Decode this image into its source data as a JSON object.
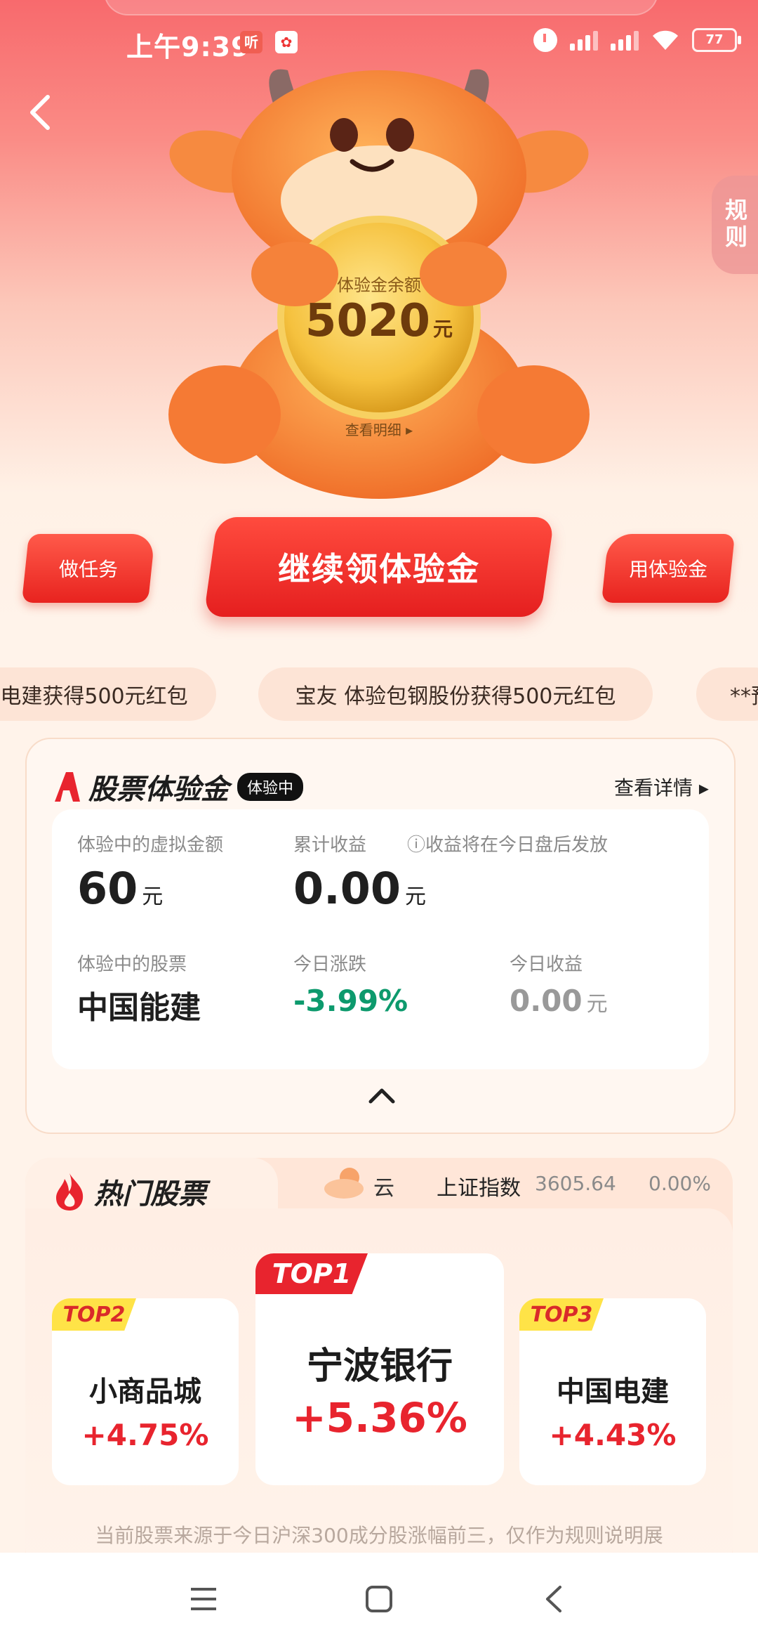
{
  "status_bar": {
    "time": "上午9:39",
    "badge_1": "听",
    "battery": "77"
  },
  "rules_tab": "规则",
  "coin": {
    "label": "体验金余额",
    "amount": "5020",
    "unit": "元",
    "link": "查看明细 ▸"
  },
  "buttons": {
    "task": "做任务",
    "main": "继续领体验金",
    "use": "用体验金"
  },
  "ticker": [
    "电建获得500元红包",
    "宝友 体验包钢股份获得500元红包",
    "**预"
  ],
  "stock_card": {
    "title": "股票体验金",
    "status_badge": "体验中",
    "detail_link": "查看详情 ▸",
    "virtual_amount_label": "体验中的虚拟金额",
    "virtual_amount": "60",
    "virtual_amount_unit": "元",
    "cumulative_label": "累计收益",
    "cumulative_note": "ⓘ收益将在今日盘后发放",
    "cumulative_value": "0.00",
    "cumulative_unit": "元",
    "stock_label": "体验中的股票",
    "stock_name": "中国能建",
    "change_label": "今日涨跌",
    "change_value": "-3.99%",
    "today_income_label": "今日收益",
    "today_income_value": "0.00",
    "today_income_unit": "元"
  },
  "hot": {
    "title": "热门股票",
    "weather": "云",
    "index_name": "上证指数",
    "index_value": "3605.64",
    "index_change": "0.00%",
    "top1": {
      "tag": "TOP1",
      "name": "宁波银行",
      "change": "+5.36%"
    },
    "top2": {
      "tag": "TOP2",
      "name": "小商品城",
      "change": "+4.75%"
    },
    "top3": {
      "tag": "TOP3",
      "name": "中国电建",
      "change": "+4.43%"
    },
    "disclaimer": "当前股票来源于今日沪深300成分股涨幅前三，仅作为规则说明展"
  },
  "colors": {
    "accent_red": "#e8242e",
    "down_green": "#0d9a6d",
    "tag_yellow": "#ffe347"
  }
}
